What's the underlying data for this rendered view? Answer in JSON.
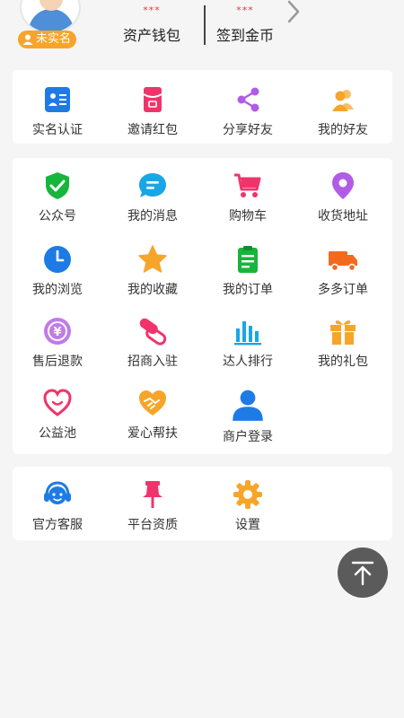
{
  "header": {
    "verify_badge": "未实名",
    "wallet": {
      "value": "***",
      "label": "资产钱包"
    },
    "coins": {
      "value": "***",
      "label": "签到金币"
    }
  },
  "quick_menu": [
    {
      "label": "实名认证",
      "icon": "id-card-icon",
      "color": "#1e7be6"
    },
    {
      "label": "邀请红包",
      "icon": "red-envelope-icon",
      "color": "#f0346b"
    },
    {
      "label": "分享好友",
      "icon": "share-icon",
      "color": "#b05ce6"
    },
    {
      "label": "我的好友",
      "icon": "friends-icon",
      "color": "#f7a52a"
    }
  ],
  "main_menu": [
    {
      "label": "公众号",
      "icon": "shield-check-icon",
      "color": "#16b53b"
    },
    {
      "label": "我的消息",
      "icon": "message-icon",
      "color": "#1aa6e6"
    },
    {
      "label": "购物车",
      "icon": "cart-icon",
      "color": "#f0346b"
    },
    {
      "label": "收货地址",
      "icon": "location-pin-icon",
      "color": "#b05ce6"
    },
    {
      "label": "我的浏览",
      "icon": "clock-icon",
      "color": "#1e7be6"
    },
    {
      "label": "我的收藏",
      "icon": "star-icon",
      "color": "#f7a52a"
    },
    {
      "label": "我的订单",
      "icon": "clipboard-icon",
      "color": "#16b53b"
    },
    {
      "label": "多多订单",
      "icon": "truck-icon",
      "color": "#f36a1f"
    },
    {
      "label": "售后退款",
      "icon": "refund-icon",
      "color": "#b05ce6"
    },
    {
      "label": "招商入驻",
      "icon": "paperclip-icon",
      "color": "#f0346b"
    },
    {
      "label": "达人排行",
      "icon": "bar-chart-icon",
      "color": "#1aa6e6"
    },
    {
      "label": "我的礼包",
      "icon": "gift-icon",
      "color": "#f7a52a"
    },
    {
      "label": "公益池",
      "icon": "heart-outline-icon",
      "color": "#f0346b"
    },
    {
      "label": "爱心帮扶",
      "icon": "handshake-icon",
      "color": "#f7a52a"
    },
    {
      "label": "商户登录",
      "icon": "user-icon",
      "color": "#1e7be6"
    }
  ],
  "service_menu": [
    {
      "label": "官方客服",
      "icon": "headset-icon",
      "color": "#1e7be6"
    },
    {
      "label": "平台资质",
      "icon": "pin-icon",
      "color": "#f0346b"
    },
    {
      "label": "设置",
      "icon": "gear-icon",
      "color": "#f7a52a"
    }
  ]
}
